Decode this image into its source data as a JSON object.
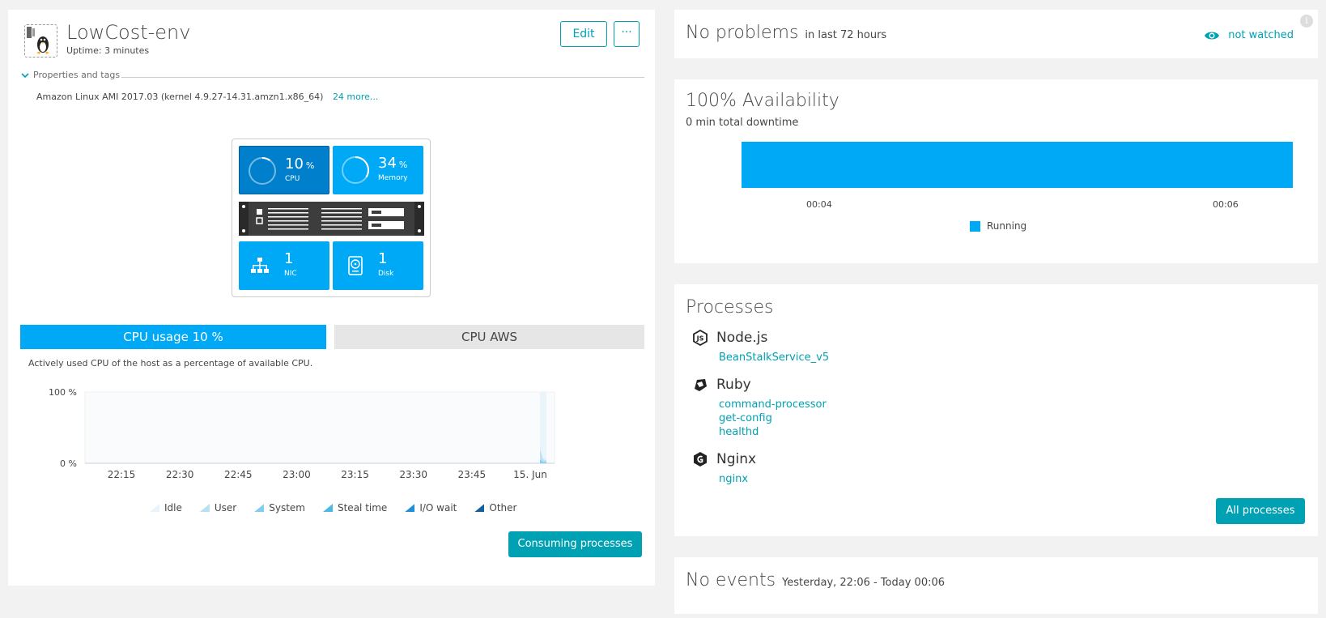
{
  "host": {
    "title": "LowCost-env",
    "uptime": "Uptime: 3 minutes",
    "edit_label": "Edit",
    "more_label": "···",
    "props_label": "Properties and tags",
    "os": "Amazon Linux AMI 2017.03 (kernel 4.9.27-14.31.amzn1.x86_64)",
    "props_more": "24 more...",
    "tiles": {
      "cpu": {
        "value": "10",
        "unit": "%",
        "label": "CPU",
        "percent": 10
      },
      "memory": {
        "value": "34",
        "unit": "%",
        "label": "Memory",
        "percent": 34
      },
      "nic": {
        "value": "1",
        "label": "NIC"
      },
      "disk": {
        "value": "1",
        "label": "Disk"
      }
    },
    "tabs": {
      "cpu_usage": "CPU usage 10 %",
      "cpu_aws": "CPU AWS"
    },
    "tab_desc": "Actively used CPU of the host as a percentage of available CPU.",
    "consuming_label": "Consuming processes"
  },
  "cpu_chart_legend": [
    "Idle",
    "User",
    "System",
    "Steal time",
    "I/O wait",
    "Other"
  ],
  "chart_data": {
    "type": "area",
    "title": "",
    "ylabel": "",
    "xlabel": "",
    "y_ticks": [
      "100 %",
      "0 %"
    ],
    "ylim": [
      0,
      100
    ],
    "x_ticks": [
      "22:15",
      "22:30",
      "22:45",
      "23:00",
      "23:15",
      "23:30",
      "23:45",
      "15. Jun"
    ],
    "series": [
      {
        "name": "Idle",
        "color": "#e8f4fb",
        "x": [
          "00:04",
          "00:05",
          "00:06"
        ],
        "values": [
          100,
          100,
          100
        ]
      },
      {
        "name": "User",
        "color": "#b8e0f5",
        "x": [
          "00:04",
          "00:05",
          "00:06"
        ],
        "values": [
          20,
          6,
          4
        ]
      },
      {
        "name": "System",
        "color": "#7fcdf0",
        "x": [
          "00:04",
          "00:05",
          "00:06"
        ],
        "values": [
          5,
          2,
          2
        ]
      },
      {
        "name": "Steal time",
        "color": "#4db8e8",
        "x": [
          "00:04",
          "00:05",
          "00:06"
        ],
        "values": [
          0,
          0,
          0
        ]
      },
      {
        "name": "I/O wait",
        "color": "#1f8fd6",
        "x": [
          "00:04",
          "00:05",
          "00:06"
        ],
        "values": [
          0,
          0,
          0
        ]
      },
      {
        "name": "Other",
        "color": "#145fa0",
        "x": [
          "00:04",
          "00:05",
          "00:06"
        ],
        "values": [
          0,
          0,
          0
        ]
      }
    ],
    "legend_position": "bottom",
    "grid": false
  },
  "problems": {
    "title": "No problems",
    "subtitle": "in last 72 hours",
    "watch_label": "not watched",
    "info": "i"
  },
  "availability": {
    "title": "100% Availability",
    "downtime": "0 min total downtime",
    "ticks": [
      "00:04",
      "00:06"
    ],
    "legend": "Running",
    "value_percent": 100
  },
  "processes": {
    "title": "Processes",
    "groups": [
      {
        "name": "Node.js",
        "icon": "nodejs-icon",
        "items": [
          "BeanStalkService_v5"
        ]
      },
      {
        "name": "Ruby",
        "icon": "ruby-icon",
        "items": [
          "command-processor",
          "get-config",
          "healthd"
        ]
      },
      {
        "name": "Nginx",
        "icon": "nginx-icon",
        "items": [
          "nginx"
        ]
      }
    ],
    "all_label": "All processes"
  },
  "events": {
    "title": "No events",
    "range": "Yesterday, 22:06 - Today 00:06"
  },
  "colors": {
    "accent": "#00a1b2",
    "tile_blue": "#00a9f6",
    "tile_selected": "#0080cc"
  }
}
